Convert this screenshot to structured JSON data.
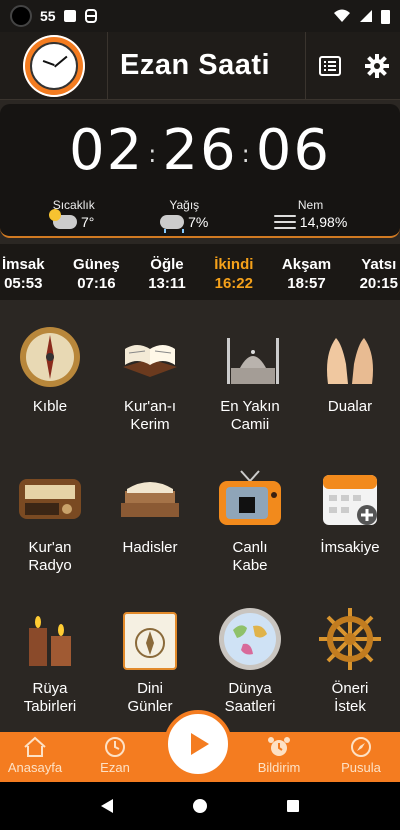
{
  "statusbar": {
    "time": "55"
  },
  "header": {
    "title": "Ezan Saati"
  },
  "clock": {
    "hours": "02",
    "minutes": "26",
    "seconds": "06"
  },
  "weather": {
    "temp_label": "Sıcaklık",
    "temp_value": "7°",
    "rain_label": "Yağış",
    "rain_value": "7%",
    "humidity_label": "Nem",
    "humidity_value": "14,98%"
  },
  "prayers": [
    {
      "name": "İmsak",
      "time": "05:53"
    },
    {
      "name": "Güneş",
      "time": "07:16"
    },
    {
      "name": "Öğle",
      "time": "13:11"
    },
    {
      "name": "İkindi",
      "time": "16:22"
    },
    {
      "name": "Akşam",
      "time": "18:57"
    },
    {
      "name": "Yatsı",
      "time": "20:15"
    }
  ],
  "tiles": [
    {
      "label": "Kıble",
      "icon": "compass-icon"
    },
    {
      "label": "Kur'an-ı Kerim",
      "icon": "quran-icon"
    },
    {
      "label": "En Yakın Camii",
      "icon": "mosque-icon"
    },
    {
      "label": "Dualar",
      "icon": "praying-hands-icon"
    },
    {
      "label": "Kur'an Radyo",
      "icon": "radio-icon"
    },
    {
      "label": "Hadisler",
      "icon": "books-icon"
    },
    {
      "label": "Canlı Kabe",
      "icon": "tv-icon"
    },
    {
      "label": "İmsakiye",
      "icon": "calendar-icon"
    },
    {
      "label": "Rüya Tabirleri",
      "icon": "candles-icon"
    },
    {
      "label": "Dini Günler",
      "icon": "ornament-calendar-icon"
    },
    {
      "label": "Dünya Saatleri",
      "icon": "world-map-icon"
    },
    {
      "label": "Öneri İstek",
      "icon": "ship-wheel-icon"
    }
  ],
  "bottomnav": [
    {
      "label": "Anasayfa",
      "icon": "home-icon"
    },
    {
      "label": "Ezan",
      "icon": "clock-icon"
    },
    {
      "label": "Bildirim",
      "icon": "alarm-icon"
    },
    {
      "label": "Pusula",
      "icon": "compass-nav-icon"
    }
  ],
  "colors": {
    "accent": "#f47c20",
    "active_prayer": "#f5a11a",
    "background": "#2b2723"
  }
}
